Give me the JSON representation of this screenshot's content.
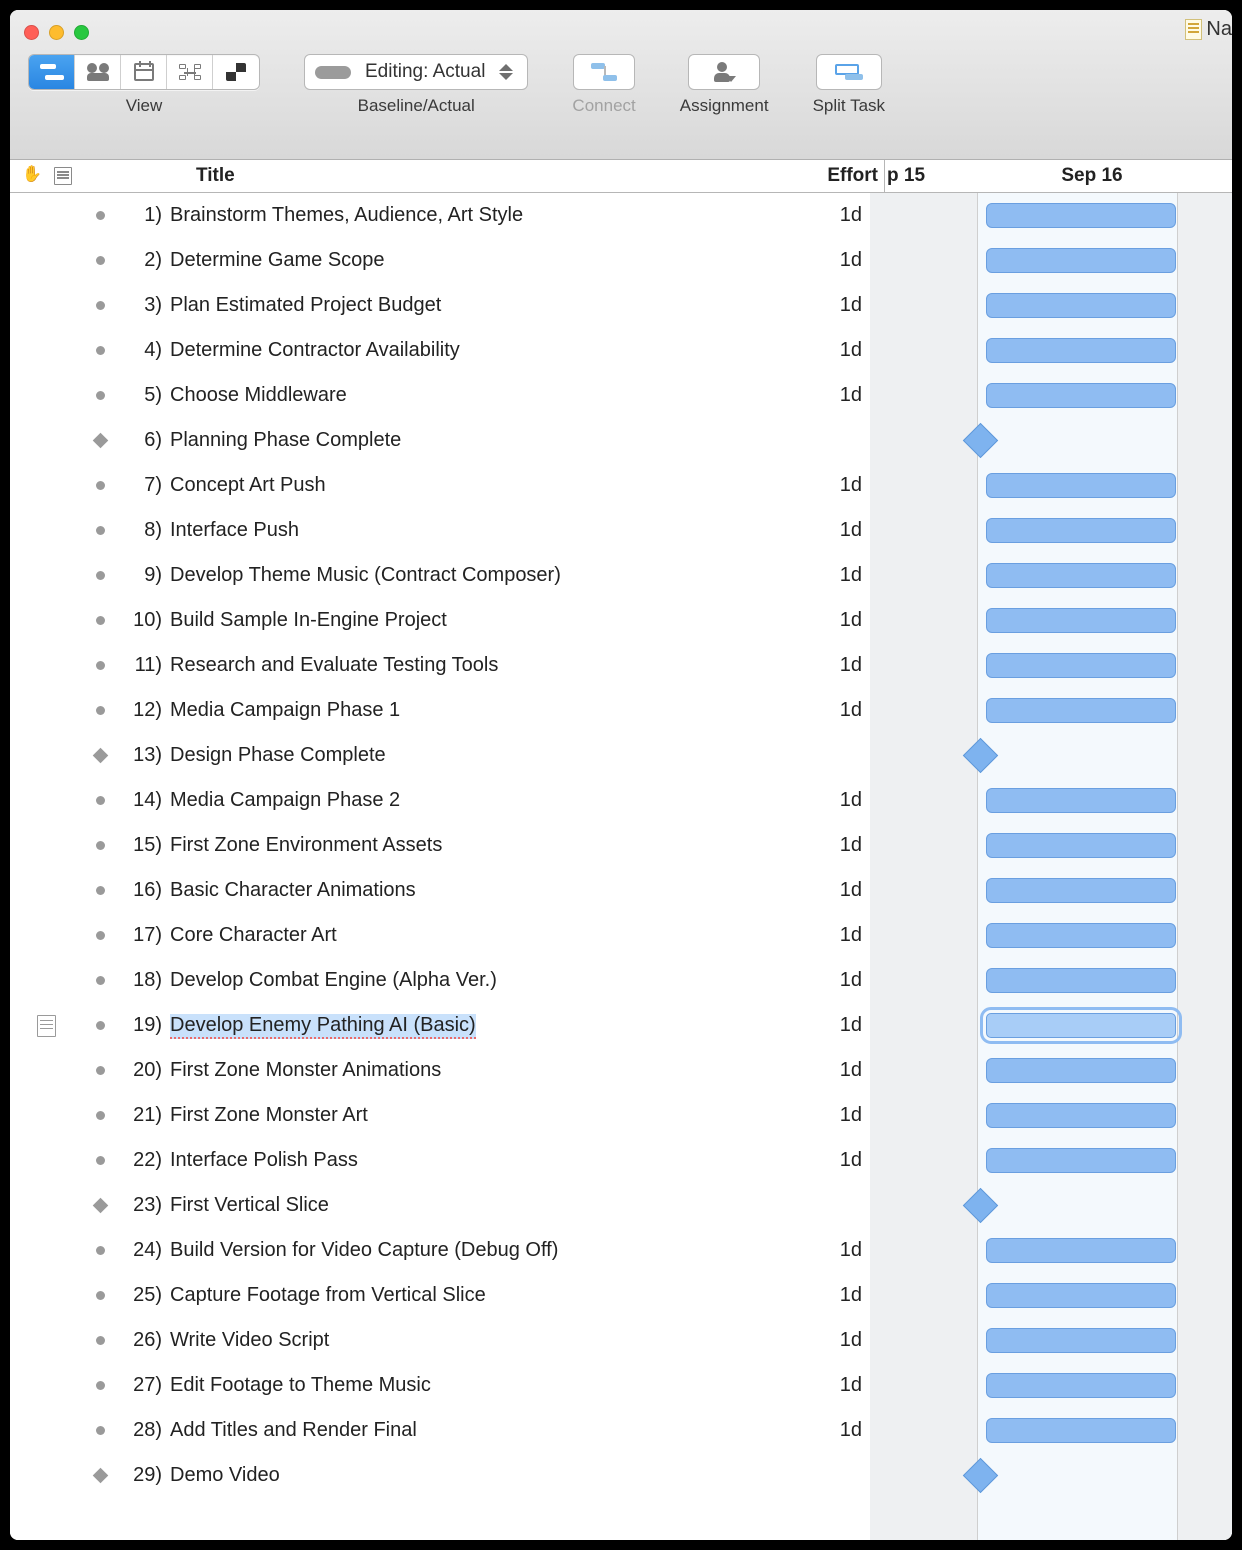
{
  "window": {
    "corner_label": "Na"
  },
  "toolbar": {
    "view_label": "View",
    "baseline_text": "Editing: Actual",
    "baseline_label": "Baseline/Actual",
    "connect_label": "Connect",
    "assignment_label": "Assignment",
    "split_label": "Split Task"
  },
  "columns": {
    "title": "Title",
    "effort": "Effort",
    "date1": "p 15",
    "date2": "Sep 16"
  },
  "tasks": [
    {
      "n": "1)",
      "title": "Brainstorm Themes, Audience, Art Style",
      "effort": "1d",
      "type": "task"
    },
    {
      "n": "2)",
      "title": "Determine Game Scope",
      "effort": "1d",
      "type": "task"
    },
    {
      "n": "3)",
      "title": "Plan Estimated Project Budget",
      "effort": "1d",
      "type": "task"
    },
    {
      "n": "4)",
      "title": "Determine Contractor Availability",
      "effort": "1d",
      "type": "task"
    },
    {
      "n": "5)",
      "title": "Choose Middleware",
      "effort": "1d",
      "type": "task"
    },
    {
      "n": "6)",
      "title": "Planning Phase Complete",
      "effort": "",
      "type": "milestone"
    },
    {
      "n": "7)",
      "title": "Concept Art Push",
      "effort": "1d",
      "type": "task"
    },
    {
      "n": "8)",
      "title": "Interface Push",
      "effort": "1d",
      "type": "task"
    },
    {
      "n": "9)",
      "title": "Develop Theme Music (Contract Composer)",
      "effort": "1d",
      "type": "task"
    },
    {
      "n": "10)",
      "title": "Build Sample In-Engine Project",
      "effort": "1d",
      "type": "task"
    },
    {
      "n": "11)",
      "title": "Research and Evaluate Testing Tools",
      "effort": "1d",
      "type": "task"
    },
    {
      "n": "12)",
      "title": "Media Campaign Phase 1",
      "effort": "1d",
      "type": "task"
    },
    {
      "n": "13)",
      "title": "Design Phase Complete",
      "effort": "",
      "type": "milestone"
    },
    {
      "n": "14)",
      "title": "Media Campaign Phase 2",
      "effort": "1d",
      "type": "task"
    },
    {
      "n": "15)",
      "title": "First Zone Environment Assets",
      "effort": "1d",
      "type": "task"
    },
    {
      "n": "16)",
      "title": "Basic Character Animations",
      "effort": "1d",
      "type": "task"
    },
    {
      "n": "17)",
      "title": "Core Character Art",
      "effort": "1d",
      "type": "task"
    },
    {
      "n": "18)",
      "title": "Develop Combat Engine (Alpha Ver.)",
      "effort": "1d",
      "type": "task"
    },
    {
      "n": "19)",
      "title": "Develop Enemy Pathing AI (Basic)",
      "effort": "1d",
      "type": "task",
      "selected": true,
      "note": true
    },
    {
      "n": "20)",
      "title": "First Zone Monster Animations",
      "effort": "1d",
      "type": "task"
    },
    {
      "n": "21)",
      "title": "First Zone Monster Art",
      "effort": "1d",
      "type": "task"
    },
    {
      "n": "22)",
      "title": "Interface Polish Pass",
      "effort": "1d",
      "type": "task"
    },
    {
      "n": "23)",
      "title": "First Vertical Slice",
      "effort": "",
      "type": "milestone"
    },
    {
      "n": "24)",
      "title": "Build Version for Video Capture (Debug Off)",
      "effort": "1d",
      "type": "task"
    },
    {
      "n": "25)",
      "title": "Capture Footage from Vertical Slice",
      "effort": "1d",
      "type": "task"
    },
    {
      "n": "26)",
      "title": "Write Video Script",
      "effort": "1d",
      "type": "task"
    },
    {
      "n": "27)",
      "title": "Edit Footage to Theme Music",
      "effort": "1d",
      "type": "task"
    },
    {
      "n": "28)",
      "title": "Add Titles and Render Final",
      "effort": "1d",
      "type": "task"
    },
    {
      "n": "29)",
      "title": "Demo Video",
      "effort": "",
      "type": "milestone"
    }
  ]
}
